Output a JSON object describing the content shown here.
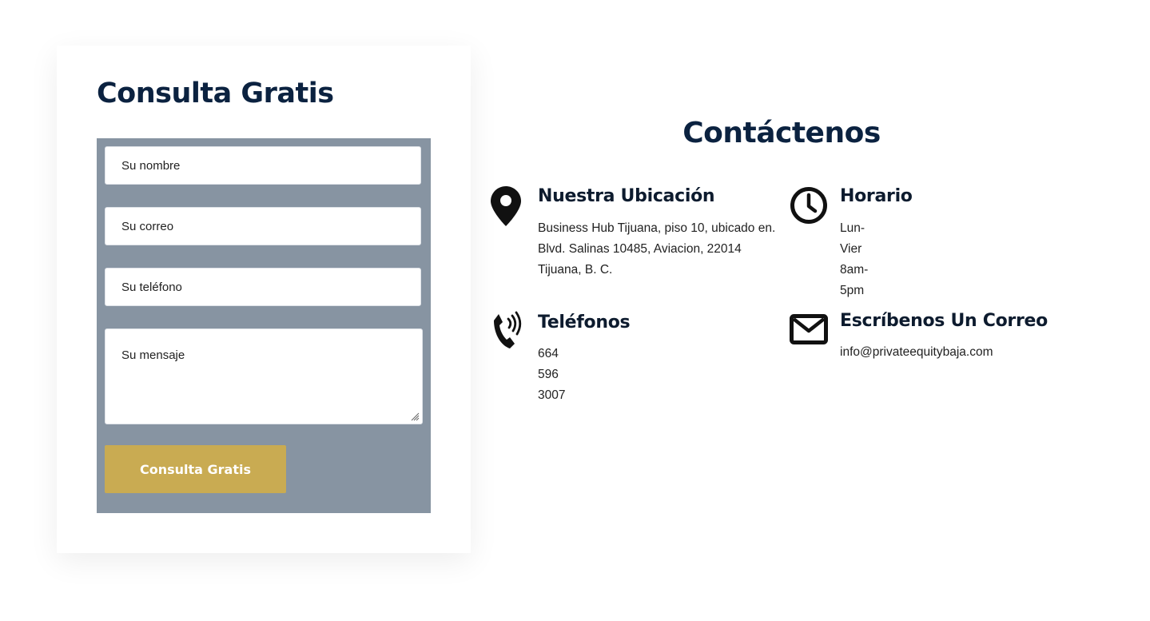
{
  "form": {
    "title": "Consulta Gratis",
    "name_placeholder": "Su nombre",
    "email_placeholder": "Su correo",
    "phone_placeholder": "Su teléfono",
    "message_placeholder": "Su mensaje",
    "submit_label": "Consulta Gratis"
  },
  "contact": {
    "title": "Contáctenos",
    "location": {
      "icon": "map-pin-icon",
      "heading": "Nuestra Ubicación",
      "text": "Business Hub Tijuana, piso 10, ubicado en.\nBlvd. Salinas 10485, Aviacion, 22014\nTijuana, B. C."
    },
    "hours": {
      "icon": "clock-icon",
      "heading": "Horario",
      "text": "Lun-Vier 8am-5pm"
    },
    "phones": {
      "icon": "phone-icon",
      "heading": "Teléfonos",
      "text": "664 596 3007"
    },
    "email": {
      "icon": "envelope-icon",
      "heading": "Escríbenos Un Correo",
      "text": "info@privateequitybaja.com"
    }
  },
  "colors": {
    "heading": "#0b2240",
    "form_panel": "#8794a2",
    "button": "#c9ab52",
    "icon": "#111111"
  }
}
